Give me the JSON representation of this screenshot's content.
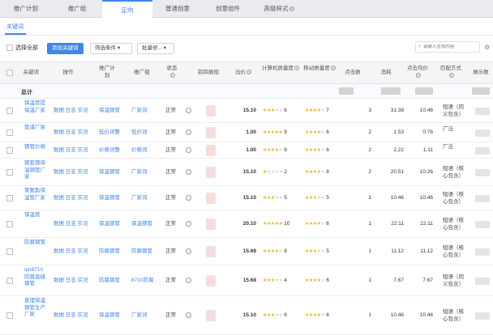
{
  "tabs": [
    "推广计划",
    "推广组",
    "定向",
    "普通创意",
    "创意组件",
    "高级样式"
  ],
  "subnav": {
    "keyword_tab": "关键词"
  },
  "toolbar": {
    "select_all": "选择全部",
    "add_keyword": "添加关键词",
    "filter": "筛选条件",
    "batch": "批量修...",
    "search_placeholder": "请输入查找内容"
  },
  "headers": [
    "关键词",
    "操作",
    "推广计划",
    "推广组",
    "状态",
    "前四展现",
    "出价",
    "计算机质量度",
    "移动质量度",
    "点击数",
    "消耗",
    "点击均价",
    "匹配方式",
    "展示数"
  ],
  "total": {
    "label": "总计"
  },
  "rows": [
    {
      "kw": "保温管提保温厂家",
      "ops": "数据 日志 实况",
      "plan": "保温钢管",
      "group": "厂家词",
      "status": "正常",
      "bid": "15.10",
      "pc_q": 6,
      "pc_stars": 3,
      "mob_q": 7,
      "mob_stars": 4,
      "clicks": "3",
      "cost": "31.38",
      "avg": "10.46",
      "match": "短语（同义包含）"
    },
    {
      "kw": "管道厂家",
      "ops": "数据 日志 实况",
      "plan": "低价词整",
      "group": "低价词",
      "status": "正常",
      "bid": "1.00",
      "pc_q": 9,
      "pc_stars": 5,
      "mob_q": 6,
      "mob_stars": 4,
      "clicks": "2",
      "cost": "1.53",
      "avg": "0.76",
      "match": "广泛"
    },
    {
      "kw": "钢管价格",
      "ops": "数据 日志 实况",
      "plan": "价格词整",
      "group": "价格词",
      "status": "正常",
      "bid": "1.00",
      "pc_q": 8,
      "pc_stars": 4,
      "mob_q": 6,
      "mob_stars": 4,
      "clicks": "2",
      "cost": "2.22",
      "avg": "1.11",
      "match": "广泛"
    },
    {
      "kw": "钢套钢保温钢管厂家",
      "ops": "数据 日志 实况",
      "plan": "保温钢管",
      "group": "厂家词",
      "status": "正常",
      "bid": "15.10",
      "pc_q": 2,
      "pc_stars": 1,
      "mob_q": 8,
      "mob_stars": 4,
      "clicks": "2",
      "cost": "20.51",
      "avg": "10.26",
      "match": "短语（核心包含）"
    },
    {
      "kw": "聚氨酯保温管厂家",
      "ops": "数据 日志 实况",
      "plan": "保温钢管",
      "group": "厂家词",
      "status": "正常",
      "bid": "15.10",
      "pc_q": 5,
      "pc_stars": 3,
      "mob_q": 5,
      "mob_stars": 3,
      "clicks": "1",
      "cost": "10.46",
      "avg": "10.46",
      "match": "短语（核心包含）"
    },
    {
      "kw": "保温管",
      "ops": "数据 日志 实况",
      "plan": "保温钢管",
      "group": "保温钢管",
      "status": "正常",
      "bid": "20.10",
      "pc_q": 10,
      "pc_stars": 5,
      "mob_q": 6,
      "mob_stars": 4,
      "clicks": "1",
      "cost": "22.11",
      "avg": "22.11",
      "match": "短语（核心包含）"
    },
    {
      "kw": "防腐钢管",
      "ops": "数据 日志 实况",
      "plan": "防腐钢管",
      "group": "防腐钢管",
      "status": "正常",
      "bid": "15.68",
      "pc_q": 8,
      "pc_stars": 4,
      "mob_q": 5,
      "mob_stars": 3,
      "clicks": "1",
      "cost": "11.12",
      "avg": "11.12",
      "match": "短语（核心包含）"
    },
    {
      "kw": "ipn8710防腐直缝钢管",
      "ops": "数据 日志 实况",
      "plan": "防腐钢管",
      "group": "8710防腐",
      "status": "正常",
      "bid": "15.68",
      "pc_q": 4,
      "pc_stars": 3,
      "mob_q": 6,
      "mob_stars": 4,
      "clicks": "1",
      "cost": "7.67",
      "avg": "7.67",
      "match": "短语（同义包含）"
    },
    {
      "kw": "直埋保温钢管生产厂家",
      "ops": "数据 日志 实况",
      "plan": "保温钢管",
      "group": "厂家词",
      "status": "正常",
      "bid": "15.10",
      "pc_q": 6,
      "pc_stars": 3,
      "mob_q": 6,
      "mob_stars": 4,
      "clicks": "1",
      "cost": "10.46",
      "avg": "10.46",
      "match": "短语（核心包含）"
    }
  ],
  "colors": {
    "accent": "#3f86ea",
    "star": "#f0b429"
  }
}
